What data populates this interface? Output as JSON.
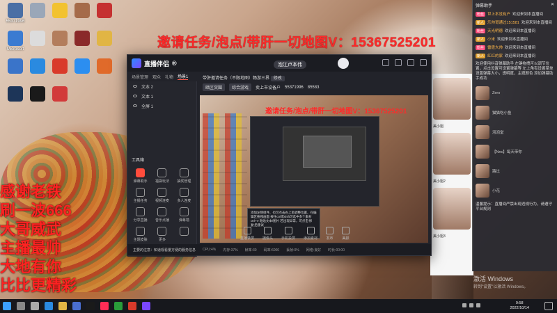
{
  "overlay": {
    "promo_text": "邀请任务/泡点/带肝一切地图V：15367525201",
    "left_text": "感谢老铁\n刷一波666\n大哥威武\n主播最帅\n大地有你\n比比更精彩"
  },
  "desktop": {
    "icons": [
      {
        "label": "55371996",
        "icon": "user-folder-icon",
        "color": "#4a6fa5"
      },
      {
        "label": "",
        "icon": "recycle-bin-icon",
        "color": "#9aa7b8"
      },
      {
        "label": "",
        "icon": "duck-app-icon",
        "color": "#f2c230"
      },
      {
        "label": "",
        "icon": "photo-icon",
        "color": "#a56b4a"
      },
      {
        "label": "",
        "icon": "game-icon",
        "color": "#c53131"
      },
      {
        "label": "Microsoft",
        "icon": "computer-icon",
        "color": "#3b7bd1"
      },
      {
        "label": "",
        "icon": "file-icon",
        "color": "#dcdcdc"
      },
      {
        "label": "",
        "icon": "photo-icon",
        "color": "#b37d5c"
      },
      {
        "label": "",
        "icon": "game-icon",
        "color": "#8a2a2a"
      },
      {
        "label": "",
        "icon": "folder-icon",
        "color": "#e1b544"
      },
      {
        "label": "",
        "icon": "app-icon",
        "color": "#3a74c9"
      },
      {
        "label": "",
        "icon": "edge-icon",
        "color": "#2a8ae0"
      },
      {
        "label": "",
        "icon": "wps-icon",
        "color": "#d93a2a"
      },
      {
        "label": "",
        "icon": "k-app-icon",
        "color": "#2c8ef0"
      },
      {
        "label": "",
        "icon": "media-icon",
        "color": "#e06a2a"
      },
      {
        "label": "",
        "icon": "steam-icon",
        "color": "#1d3558"
      },
      {
        "label": "",
        "icon": "music-icon",
        "color": "#1a1a1a"
      },
      {
        "label": "",
        "icon": "camera-icon",
        "color": "#d23a3a"
      }
    ]
  },
  "stream_app": {
    "title": "直播伴侣",
    "title_suffix": "®",
    "username": "泡江卢本伟",
    "tabs": [
      "场景管理",
      "观众",
      "礼物",
      "场景1"
    ],
    "scenes": [
      "文本 2",
      "文本 1",
      "全屏 1"
    ],
    "toolbox_label": "工具箱",
    "tools": [
      {
        "label": "弹幕助手",
        "icon": "danmaku-icon",
        "hot": true
      },
      {
        "label": "福袋玩法",
        "icon": "lucky-bag-icon",
        "hot": false
      },
      {
        "label": "抽奖管理",
        "icon": "lottery-icon",
        "hot": false
      },
      {
        "label": "主播任务",
        "icon": "task-icon",
        "hot": false
      },
      {
        "label": "视频连麦",
        "icon": "video-call-icon",
        "hot": false
      },
      {
        "label": "多人连麦",
        "icon": "multi-call-icon",
        "hot": false
      },
      {
        "label": "分享直播",
        "icon": "share-icon",
        "hot": false
      },
      {
        "label": "音乐点播",
        "icon": "music-icon",
        "hot": false
      },
      {
        "label": "弹幕墙",
        "icon": "wall-icon",
        "hot": false
      },
      {
        "label": "主题皮肤",
        "icon": "skin-icon",
        "hot": false
      },
      {
        "label": "更多",
        "icon": "more-icon",
        "hot": false
      },
      {
        "label": "",
        "icon": "blank-icon",
        "hot": false
      }
    ],
    "info": {
      "room_title": "带肝邀请任务（不限地图）畅游三界",
      "edit_label": "修改",
      "tag1": "暗区突围",
      "tag2": "综合游戏",
      "user_tag": "卖上市设备户",
      "id": "55371996",
      "fans": "85583"
    },
    "preview_promo": "邀请任务/泡点/带肝一切地图V：15367525201",
    "tooltip_text": "添加左侧组件、也可点击右上角调整位置、在编辑区拖拽画面 按住ctrl或shift可选中多个素材 ctrl+V 粘贴文本/图片 若出现异常，可点击'修复'后重试",
    "bottom_tools": [
      "直播录屏",
      "摄像头",
      "手机投屏",
      "添加素材",
      "发布",
      "美颜"
    ],
    "status": {
      "notice": "主要的注意：知道观看量方便的服务信息",
      "items": [
        "CPU:4%",
        "内存:37%",
        "帧率:30",
        "码率:6000",
        "丢帧:0%",
        "网络:良好",
        "时长:00:00"
      ]
    }
  },
  "webpage": {
    "cards": [
      "美小姐",
      "美小姐2",
      "美小姐3"
    ]
  },
  "chat": {
    "header": "弹幕助手",
    "lines": [
      {
        "badge": "粉丝",
        "badge_color": "#ff4a7a",
        "name": "世上本没有户",
        "text": "欢迎来到本直播间"
      },
      {
        "badge": "新人",
        "badge_color": "#e0a030",
        "name": "乐帅哥通过151581",
        "text": "欢迎来到本直播间"
      },
      {
        "badge": "粉丝",
        "badge_color": "#ff4a7a",
        "name": "天光明德",
        "text": "欢迎来到本直播间"
      },
      {
        "badge": "新人",
        "badge_color": "#e0a030",
        "name": "小米",
        "text": "欢迎来到本直播间"
      },
      {
        "badge": "粉丝",
        "badge_color": "#ff4a7a",
        "name": "雷霆大帅",
        "text": "欢迎来到本直播间"
      },
      {
        "badge": "新人",
        "badge_color": "#e0a030",
        "name": "红红的家",
        "text": "欢迎来到本直播间"
      }
    ],
    "welcome": "欢迎使用抖音弹幕助手 左键拖拽可以调节位置，点击设置可设置弹幕等 左上角有设置菜单 设置弹幕大小，透明度，主题颜色 添加弹幕助手成功",
    "entries": [
      {
        "name": "Zero",
        "text": ""
      },
      {
        "name": "猫猫吃小鱼",
        "text": ""
      },
      {
        "name": "泡泡堂",
        "text": ""
      },
      {
        "name": "【Nnc】每天带你",
        "text": ""
      },
      {
        "name": "路过",
        "text": ""
      },
      {
        "name": "小花",
        "text": ""
      }
    ],
    "footer_notice": "温馨提示：直播间严禁出现违规行为，请遵守平台规则"
  },
  "windows": {
    "activate_title": "激活 Windows",
    "activate_sub": "转到\"设置\"以激活 Windows。"
  },
  "taskbar": {
    "time": "9:58",
    "date": "2022/10/14",
    "apps": [
      {
        "icon": "windows-start-icon",
        "color": "#3ca0ff"
      },
      {
        "icon": "search-icon",
        "color": "#888"
      },
      {
        "icon": "task-view-icon",
        "color": "#aaa"
      },
      {
        "icon": "edge-icon",
        "color": "#2a8ae0"
      },
      {
        "icon": "folder-icon",
        "color": "#e1b544"
      },
      {
        "icon": "store-icon",
        "color": "#4a6fd1"
      },
      {
        "icon": "music-icon",
        "color": "#1a1a1a"
      },
      {
        "icon": "douyin-icon",
        "color": "#ff2d55"
      },
      {
        "icon": "chat-icon",
        "color": "#2a9d3a"
      },
      {
        "icon": "wps-icon",
        "color": "#d93a2a"
      },
      {
        "icon": "stream-icon",
        "color": "#7a47ff"
      }
    ]
  }
}
